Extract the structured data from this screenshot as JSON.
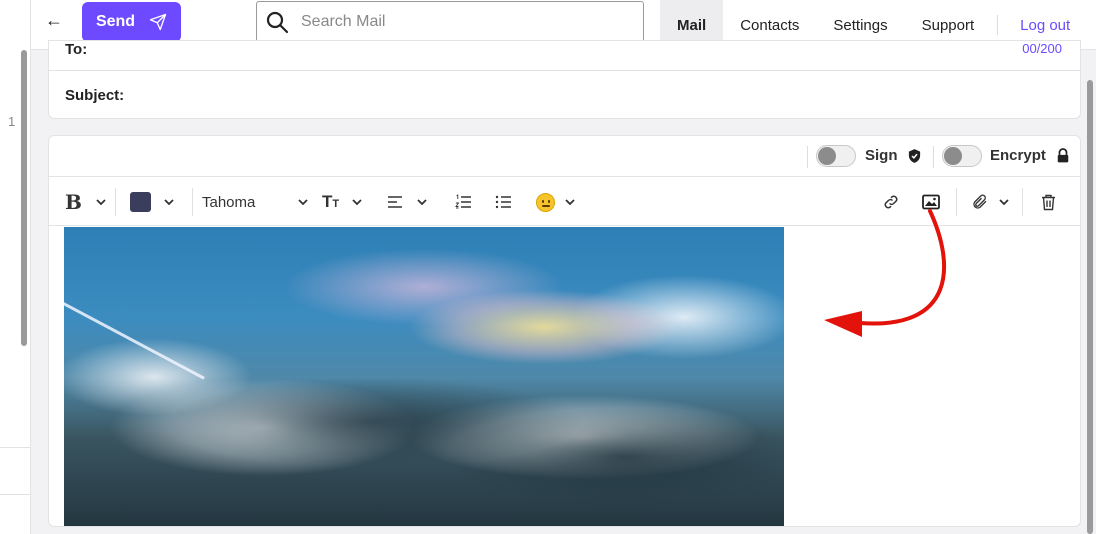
{
  "gutter": {
    "line_number": "1"
  },
  "topbar": {
    "back_icon": "back-arrow-icon",
    "send_label": "Send",
    "send_icon": "paper-plane-icon",
    "search_placeholder": "Search Mail",
    "search_value": "",
    "nav": [
      "Mail",
      "Contacts",
      "Settings",
      "Support"
    ],
    "active_nav": "Mail",
    "logout_label": "Log out",
    "accent_color": "#6d4aff"
  },
  "header": {
    "to_label": "To:",
    "to_count": "00/200",
    "subject_label": "Subject:",
    "subject_value": ""
  },
  "sign_bar": {
    "sign_label": "Sign",
    "sign_enabled": false,
    "encrypt_label": "Encrypt",
    "encrypt_enabled": false
  },
  "toolbar": {
    "font_name": "Tahoma",
    "text_color": "#3a3d5c",
    "icons": [
      "bold-icon",
      "text-color-icon",
      "font-family-select",
      "font-size-icon",
      "align-icon",
      "ordered-list-icon",
      "bullet-list-icon",
      "emoji-icon",
      "link-icon",
      "image-icon",
      "attachment-icon",
      "trash-icon"
    ]
  },
  "editor": {
    "image_description_icon": "inline-image",
    "annotation": "red-arrow-icon"
  }
}
